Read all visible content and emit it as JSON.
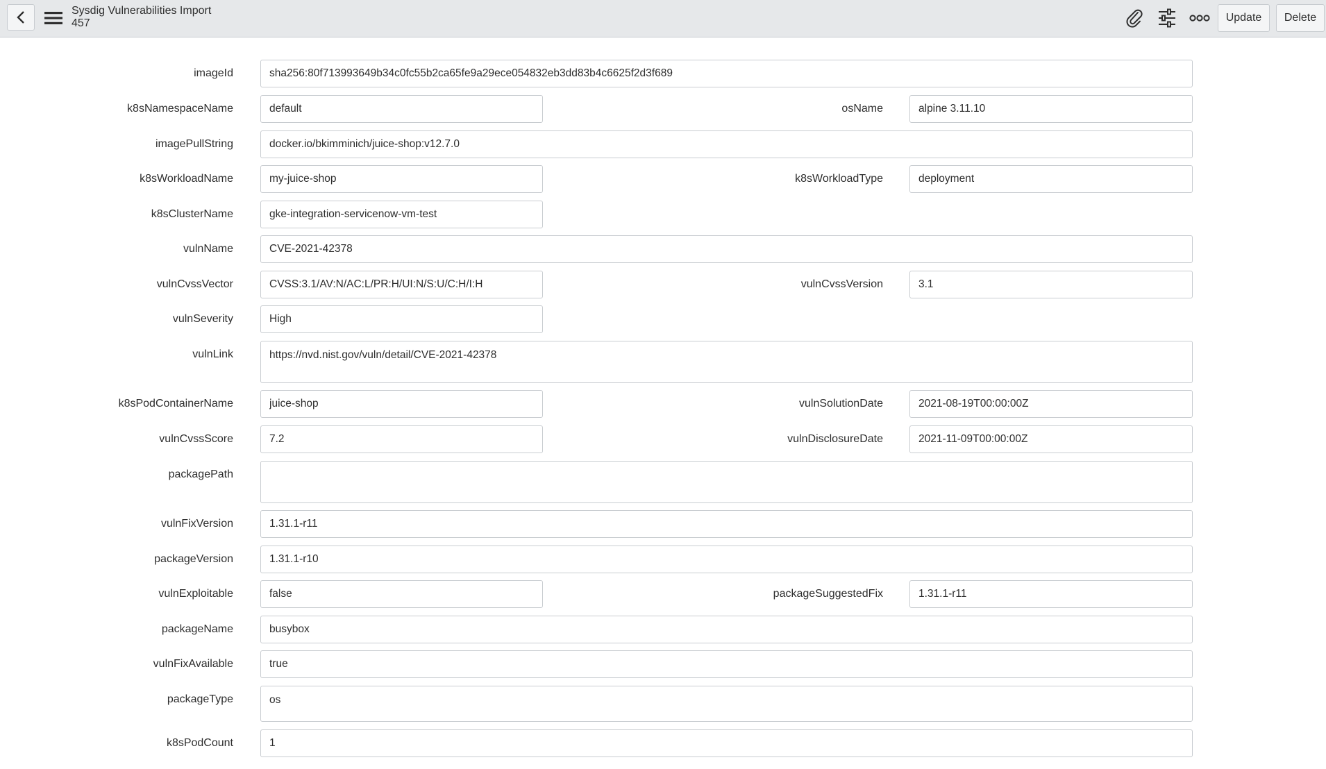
{
  "header": {
    "title": "Sysdig Vulnerabilities Import",
    "subtitle": "457",
    "back_icon": "chevron-left-icon",
    "menu_icon": "hamburger-menu-icon",
    "attachment_icon": "paperclip-icon",
    "settings_icon": "sliders-icon",
    "more_icon": "more-options-icon",
    "update_label": "Update",
    "delete_label": "Delete"
  },
  "fields": {
    "imageId": {
      "label": "imageId",
      "value": "sha256:80f713993649b34c0fc55b2ca65fe9a29ece054832eb3dd83b4c6625f2d3f689"
    },
    "k8sNamespaceName": {
      "label": "k8sNamespaceName",
      "value": "default"
    },
    "osName": {
      "label": "osName",
      "value": "alpine 3.11.10"
    },
    "imagePullString": {
      "label": "imagePullString",
      "value": "docker.io/bkimminich/juice-shop:v12.7.0"
    },
    "k8sWorkloadName": {
      "label": "k8sWorkloadName",
      "value": "my-juice-shop"
    },
    "k8sWorkloadType": {
      "label": "k8sWorkloadType",
      "value": "deployment"
    },
    "k8sClusterName": {
      "label": "k8sClusterName",
      "value": "gke-integration-servicenow-vm-test"
    },
    "vulnName": {
      "label": "vulnName",
      "value": "CVE-2021-42378"
    },
    "vulnCvssVector": {
      "label": "vulnCvssVector",
      "value": "CVSS:3.1/AV:N/AC:L/PR:H/UI:N/S:U/C:H/I:H"
    },
    "vulnCvssVersion": {
      "label": "vulnCvssVersion",
      "value": "3.1"
    },
    "vulnSeverity": {
      "label": "vulnSeverity",
      "value": "High"
    },
    "vulnLink": {
      "label": "vulnLink",
      "value": "https://nvd.nist.gov/vuln/detail/CVE-2021-42378"
    },
    "k8sPodContainerName": {
      "label": "k8sPodContainerName",
      "value": "juice-shop"
    },
    "vulnSolutionDate": {
      "label": "vulnSolutionDate",
      "value": "2021-08-19T00:00:00Z"
    },
    "vulnCvssScore": {
      "label": "vulnCvssScore",
      "value": "7.2"
    },
    "vulnDisclosureDate": {
      "label": "vulnDisclosureDate",
      "value": "2021-11-09T00:00:00Z"
    },
    "packagePath": {
      "label": "packagePath",
      "value": ""
    },
    "vulnFixVersion": {
      "label": "vulnFixVersion",
      "value": "1.31.1-r11"
    },
    "packageVersion": {
      "label": "packageVersion",
      "value": "1.31.1-r10"
    },
    "vulnExploitable": {
      "label": "vulnExploitable",
      "value": "false"
    },
    "packageSuggestedFix": {
      "label": "packageSuggestedFix",
      "value": "1.31.1-r11"
    },
    "packageName": {
      "label": "packageName",
      "value": "busybox"
    },
    "vulnFixAvailable": {
      "label": "vulnFixAvailable",
      "value": "true"
    },
    "packageType": {
      "label": "packageType",
      "value": "os"
    },
    "k8sPodCount": {
      "label": "k8sPodCount",
      "value": "1"
    }
  }
}
